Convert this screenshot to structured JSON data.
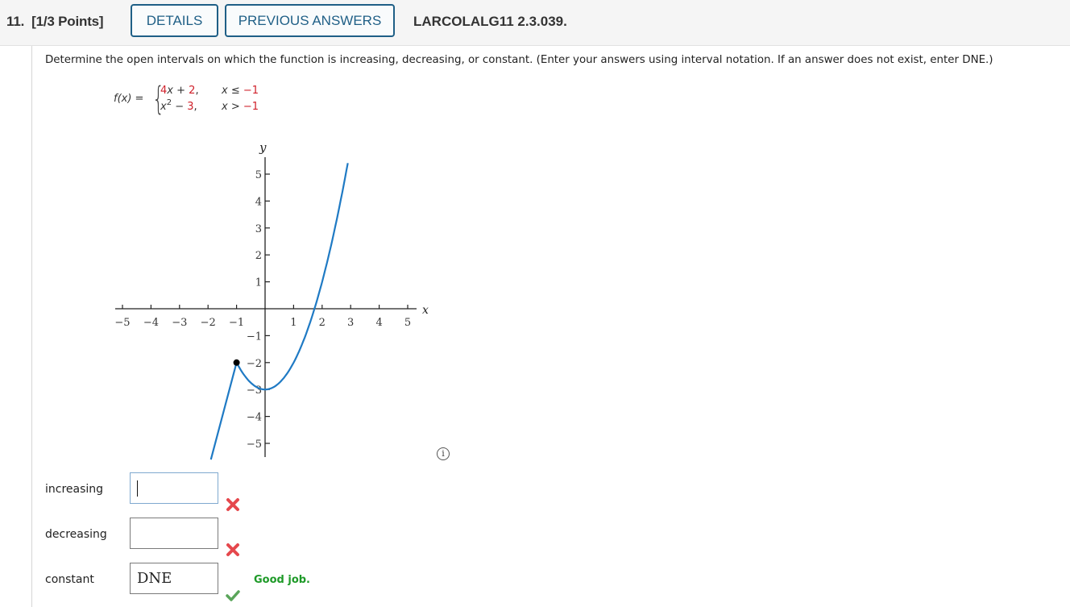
{
  "header": {
    "question_number": "11.",
    "points": "[1/3 Points]",
    "details_button": "DETAILS",
    "previous_answers_button": "PREVIOUS ANSWERS",
    "question_id": "LARCOLALG11 2.3.039."
  },
  "prompt": "Determine the open intervals on which the function is increasing, decreasing, or constant. (Enter your answers using interval notation. If an answer does not exist, enter DNE.)",
  "function": {
    "lhs": "f(x) =",
    "piece1": {
      "coef": "4",
      "var": "x",
      "op": " + ",
      "const": "2",
      "sep": ",",
      "cond_var": "x",
      "cond_op": " ≤ ",
      "cond_val": "−1"
    },
    "piece2": {
      "var": "x",
      "exp": "2",
      "op": " − ",
      "const": "3",
      "sep": ",",
      "cond_var": "x",
      "cond_op": " > ",
      "cond_val": "−1"
    }
  },
  "chart_data": {
    "type": "line",
    "title": "",
    "xlabel": "x",
    "ylabel": "y",
    "xlim": [
      -5,
      5
    ],
    "ylim": [
      -5.5,
      5.5
    ],
    "grid": false,
    "x_ticks": [
      -5,
      -4,
      -3,
      -2,
      -1,
      1,
      2,
      3,
      4,
      5
    ],
    "x_tick_labels": [
      "−5",
      "−4",
      "−3",
      "−2",
      "−1",
      "1",
      "2",
      "3",
      "4",
      "5"
    ],
    "y_ticks": [
      5,
      4,
      3,
      2,
      1,
      -1,
      -2,
      -3,
      -4,
      -5
    ],
    "y_tick_labels": [
      "5",
      "4",
      "3",
      "2",
      "1",
      "−1",
      "−2",
      "−3",
      "−4",
      "−5"
    ],
    "series": [
      {
        "name": "4x + 2 (x ≤ −1)",
        "x": [
          -1.9,
          -1
        ],
        "y": [
          -5.6,
          -2
        ],
        "color": "#1f7ac4"
      },
      {
        "name": "x^2 − 3 (x > −1)",
        "domain": [
          -1,
          2.9
        ],
        "formula": "x^2 - 3",
        "color": "#1f7ac4"
      }
    ],
    "points": [
      {
        "x": -1,
        "y": -2,
        "filled": true,
        "color": "#000000"
      }
    ]
  },
  "answers": [
    {
      "label": "increasing",
      "value": "",
      "status": "incorrect"
    },
    {
      "label": "decreasing",
      "value": "",
      "status": "incorrect"
    },
    {
      "label": "constant",
      "value": "DNE",
      "status": "correct",
      "feedback": "Good job."
    }
  ],
  "icons": {
    "info": "i"
  },
  "colors": {
    "accent": "#1f5f86",
    "curve": "#1f7ac4",
    "incorrect": "#e5484d",
    "correct": "#1e9a28"
  }
}
